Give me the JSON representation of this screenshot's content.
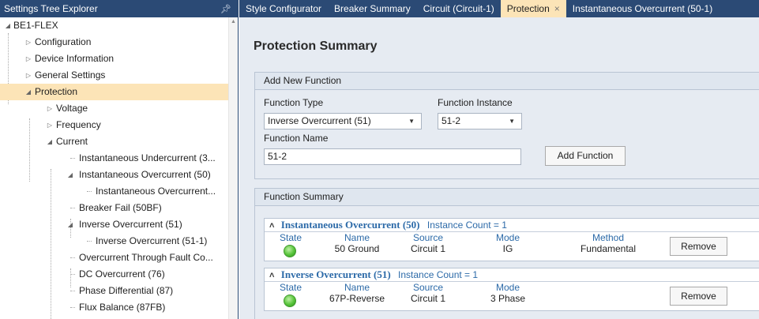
{
  "left_panel": {
    "title": "Settings Tree Explorer",
    "pin_icon": "pin-icon",
    "tree": [
      {
        "label": "BE1-FLEX",
        "toggle": "expanded"
      },
      {
        "label": "Configuration",
        "toggle": "collapsed"
      },
      {
        "label": "Device Information",
        "toggle": "collapsed"
      },
      {
        "label": "General Settings",
        "toggle": "collapsed"
      },
      {
        "label": "Protection",
        "toggle": "expanded",
        "selected": true
      },
      {
        "label": "Voltage",
        "toggle": "collapsed"
      },
      {
        "label": "Frequency",
        "toggle": "collapsed"
      },
      {
        "label": "Current",
        "toggle": "expanded"
      },
      {
        "label": "Instantaneous Undercurrent (3...",
        "toggle": "none"
      },
      {
        "label": "Instantaneous Overcurrent (50)",
        "toggle": "expanded"
      },
      {
        "label": "Instantaneous Overcurrent...",
        "toggle": "none"
      },
      {
        "label": "Breaker Fail (50BF)",
        "toggle": "none"
      },
      {
        "label": "Inverse Overcurrent (51)",
        "toggle": "expanded"
      },
      {
        "label": "Inverse Overcurrent (51-1)",
        "toggle": "none"
      },
      {
        "label": "Overcurrent Through Fault Co...",
        "toggle": "none"
      },
      {
        "label": "DC Overcurrent (76)",
        "toggle": "none"
      },
      {
        "label": "Phase Differential (87)",
        "toggle": "none"
      },
      {
        "label": "Flux Balance (87FB)",
        "toggle": "none"
      }
    ]
  },
  "tabs": [
    {
      "label": "Style Configurator"
    },
    {
      "label": "Breaker Summary"
    },
    {
      "label": "Circuit (Circuit-1)"
    },
    {
      "label": "Protection",
      "active": true,
      "close": "×"
    },
    {
      "label": "Instantaneous Overcurrent (50-1)"
    }
  ],
  "page": {
    "title": "Protection Summary",
    "add_new": {
      "header": "Add New Function",
      "function_type_label": "Function Type",
      "function_type_value": "Inverse Overcurrent (51)",
      "function_instance_label": "Function Instance",
      "function_instance_value": "51-2",
      "function_name_label": "Function Name",
      "function_name_value": "51-2",
      "add_button": "Add Function"
    },
    "summary": {
      "header": "Function Summary",
      "items": [
        {
          "function": "Instantaneous Overcurrent (50)",
          "instance_count": "Instance Count = 1",
          "headers": {
            "state": "State",
            "name": "Name",
            "source": "Source",
            "mode": "Mode",
            "method": "Method"
          },
          "values": {
            "name": "50 Ground",
            "source": "Circuit 1",
            "mode": "IG",
            "method": "Fundamental"
          },
          "remove": "Remove",
          "state_color": "#57c43a"
        },
        {
          "function": "Inverse Overcurrent (51)",
          "instance_count": "Instance Count = 1",
          "headers": {
            "state": "State",
            "name": "Name",
            "source": "Source",
            "mode": "Mode"
          },
          "values": {
            "name": "67P-Reverse",
            "source": "Circuit 1",
            "mode": "3 Phase"
          },
          "remove": "Remove",
          "state_color": "#57c43a"
        }
      ]
    }
  },
  "colors": {
    "header_bg": "#2b4a75",
    "selected_bg": "#fce4b7",
    "link_blue": "#2c6aa8"
  }
}
